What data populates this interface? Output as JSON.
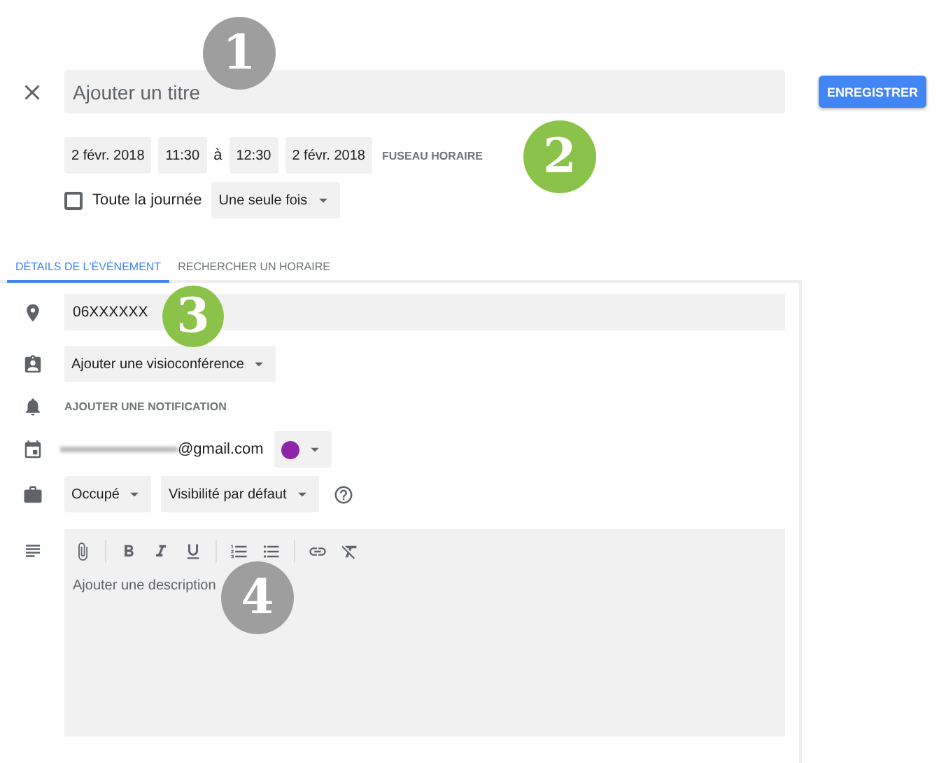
{
  "header": {
    "title_placeholder": "Ajouter un titre",
    "save_button": "ENREGISTRER"
  },
  "when": {
    "start_date": "2 févr. 2018",
    "start_time": "11:30",
    "separator": "à",
    "end_time": "12:30",
    "end_date": "2 févr. 2018",
    "timezone_link": "FUSEAU HORAIRE"
  },
  "all_day": {
    "label": "Toute la journée",
    "checked": false
  },
  "recurrence": {
    "value": "Une seule fois"
  },
  "tabs": [
    {
      "label": "DÉTAILS DE L'ÉVÉNEMENT",
      "selected": true
    },
    {
      "label": "RECHERCHER UN HORAIRE",
      "selected": false
    }
  ],
  "details": {
    "location": "06XXXXXX",
    "conference": "Ajouter une visioconférence",
    "notification_link": "AJOUTER UNE NOTIFICATION",
    "calendar": {
      "email": "@gmail.com",
      "color": "#8e24aa"
    },
    "availability": "Occupé",
    "visibility": "Visibilité par défaut",
    "description_placeholder": "Ajouter une description"
  },
  "callouts": [
    {
      "number": "1",
      "color": "#9e9e9e"
    },
    {
      "number": "2",
      "color": "#8bc34a"
    },
    {
      "number": "3",
      "color": "#8bc34a"
    },
    {
      "number": "4",
      "color": "#9e9e9e"
    }
  ]
}
